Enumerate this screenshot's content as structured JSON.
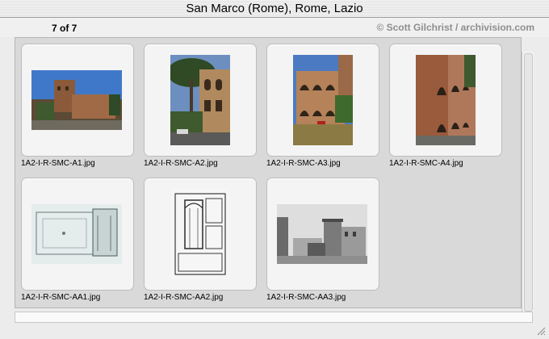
{
  "window": {
    "title": "San Marco (Rome), Rome, Lazio"
  },
  "header": {
    "count": "7 of 7",
    "credit": "© Scott Gilchrist / archivision.com"
  },
  "items": [
    {
      "filename": "1A2-I-R-SMC-A1.jpg"
    },
    {
      "filename": "1A2-I-R-SMC-A2.jpg"
    },
    {
      "filename": "1A2-I-R-SMC-A3.jpg"
    },
    {
      "filename": "1A2-I-R-SMC-A4.jpg"
    },
    {
      "filename": "1A2-I-R-SMC-AA1.jpg"
    },
    {
      "filename": "1A2-I-R-SMC-AA2.jpg"
    },
    {
      "filename": "1A2-I-R-SMC-AA3.jpg"
    }
  ]
}
